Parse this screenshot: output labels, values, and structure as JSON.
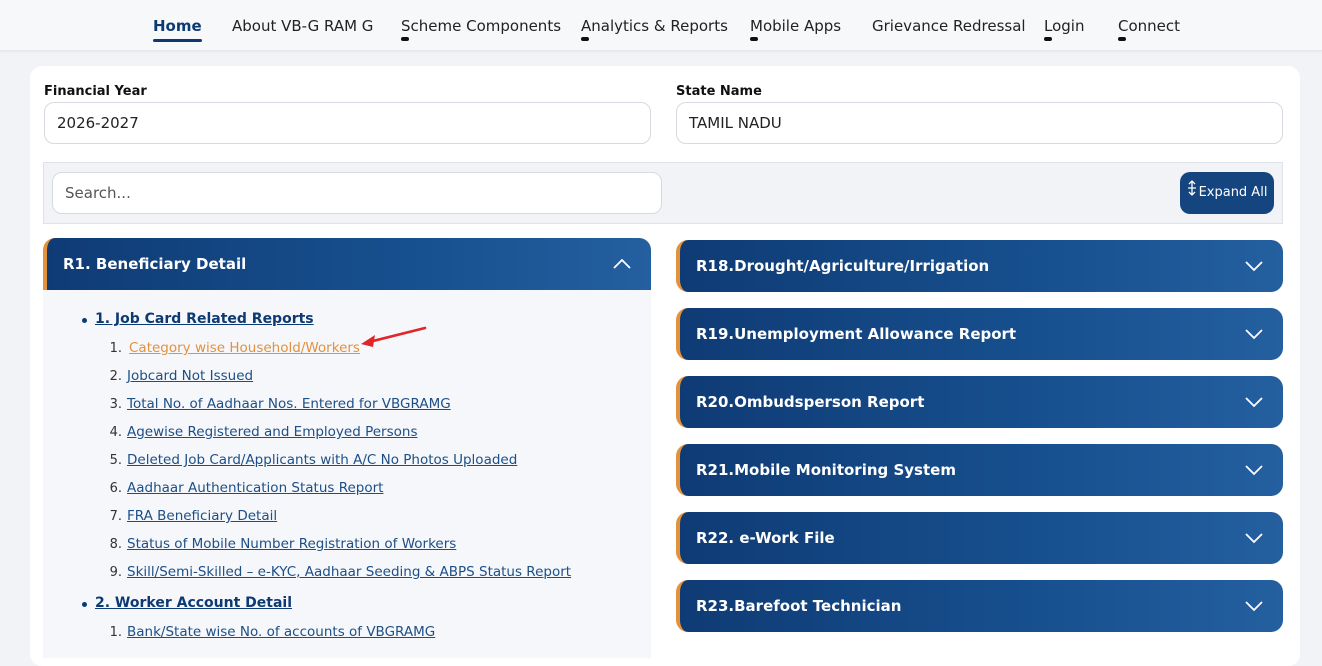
{
  "nav": {
    "items": [
      {
        "label": "Home"
      },
      {
        "label": "About VB-G RAM G"
      },
      {
        "label": "Scheme Components"
      },
      {
        "label": "Analytics & Reports"
      },
      {
        "label": "Mobile Apps"
      },
      {
        "label": "Grievance Redressal"
      },
      {
        "label": "Login"
      },
      {
        "label": "Connect"
      }
    ]
  },
  "filters": {
    "financial_year_label": "Financial Year",
    "financial_year_value": "2026-2027",
    "state_label": "State Name",
    "state_value": "TAMIL NADU"
  },
  "search": {
    "placeholder": "Search..."
  },
  "expand_button": {
    "label": "Expand All",
    "icon": "expand-vertical-icon"
  },
  "left_panel": {
    "title": "R1. Beneficiary Detail",
    "sections": [
      {
        "title": "1. Job Card Related Reports",
        "items": [
          {
            "num": "1.",
            "label": "Category wise Household/Workers"
          },
          {
            "num": "2.",
            "label": "Jobcard Not Issued"
          },
          {
            "num": "3.",
            "label": "Total No. of Aadhaar Nos. Entered for VBGRAMG"
          },
          {
            "num": "4.",
            "label": "Agewise Registered and Employed Persons"
          },
          {
            "num": "5.",
            "label": "Deleted Job Card/Applicants with A/C No Photos Uploaded"
          },
          {
            "num": "6.",
            "label": "Aadhaar Authentication Status Report"
          },
          {
            "num": "7.",
            "label": "FRA Beneficiary Detail"
          },
          {
            "num": "8.",
            "label": "Status of Mobile Number Registration of Workers"
          },
          {
            "num": "9.",
            "label": "Skill/Semi-Skilled – e-KYC, Aadhaar Seeding & ABPS Status Report"
          }
        ]
      },
      {
        "title": "2. Worker Account Detail",
        "items": [
          {
            "num": "1.",
            "label": "Bank/State wise No. of accounts of VBGRAMG"
          }
        ]
      }
    ]
  },
  "right_panels": [
    {
      "title": "R18.Drought/Agriculture/Irrigation"
    },
    {
      "title": "R19.Unemployment Allowance Report"
    },
    {
      "title": "R20.Ombudsperson Report"
    },
    {
      "title": "R21.Mobile Monitoring System"
    },
    {
      "title": "R22. e-Work File"
    },
    {
      "title": "R23.Barefoot Technician"
    }
  ],
  "colors": {
    "primary": "#0f3b75",
    "accent": "#e2913d",
    "link": "#1d4f86",
    "annotation_arrow": "#e0262b"
  }
}
